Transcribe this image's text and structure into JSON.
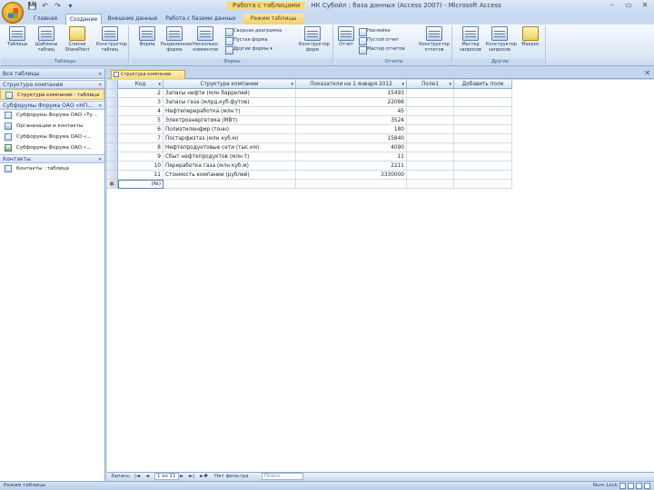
{
  "window": {
    "context_tab": "Работа с таблицами",
    "title": "НК Субойл : база данных (Access 2007) - Microsoft Access",
    "min": "–",
    "max": "▭",
    "close": "✕"
  },
  "qat": [
    "💾",
    "↶",
    "↷",
    "▾"
  ],
  "tabs": [
    {
      "label": "Главная"
    },
    {
      "label": "Создание"
    },
    {
      "label": "Внешние данные"
    },
    {
      "label": "Работа с базами данных"
    },
    {
      "label": "Режим таблицы"
    }
  ],
  "ribbon": {
    "groups": [
      {
        "name": "Таблицы",
        "buttons": [
          "Таблица",
          "Шаблоны таблиц",
          "Списки SharePoint",
          "Конструктор таблиц"
        ]
      },
      {
        "name": "Формы",
        "buttons": [
          "Форма",
          "Разделенная форма",
          "Несколько элементов",
          "Конструктор форм"
        ],
        "small": [
          "Сводная диаграмма",
          "Пустая форма",
          "Другие формы ▾"
        ]
      },
      {
        "name": "Отчеты",
        "buttons": [
          "Отчет",
          "Конструктор отчетов"
        ],
        "small": [
          "Наклейки",
          "Пустой отчет",
          "Мастер отчетов"
        ]
      },
      {
        "name": "Другие",
        "buttons": [
          "Мастер запросов",
          "Конструктор запросов",
          "Макрос"
        ]
      }
    ]
  },
  "nav": {
    "header": "Все таблицы",
    "groups": [
      {
        "label": "Структура компании",
        "chev": "«",
        "items": [
          {
            "label": "Структура компании : таблица",
            "type": "t",
            "selected": true
          }
        ]
      },
      {
        "label": "Субфорумы Форума ОАО «НП...",
        "chev": "«",
        "items": [
          {
            "label": "Субфорумы Форума ОАО «Ту...",
            "type": "t"
          },
          {
            "label": "Организации и контакты",
            "type": "q"
          },
          {
            "label": "Субфорумы Форума ОАО «...",
            "type": "t"
          },
          {
            "label": "Субфорумы Форума ОАО «...",
            "type": "f"
          }
        ]
      },
      {
        "label": "Контакты",
        "chev": "«",
        "items": [
          {
            "label": "Контакты : таблица",
            "type": "t"
          }
        ]
      }
    ]
  },
  "doc_tab": "Структура компании",
  "table": {
    "headers": [
      "Код",
      "Структура компании",
      "Показатели на 1 января 2012",
      "Поле1",
      "Добавить поле"
    ],
    "rows": [
      {
        "id": "2",
        "name": "Запасы нефти (млн баррелей)",
        "value": "15493",
        "f1": ""
      },
      {
        "id": "3",
        "name": "Запасы газа (млрд.куб.футов)",
        "value": "22086",
        "f1": ""
      },
      {
        "id": "4",
        "name": "Нефтепереработка (млн т)",
        "value": "45",
        "f1": ""
      },
      {
        "id": "5",
        "name": "Электроэнергетика (МВт)",
        "value": "3524",
        "f1": ""
      },
      {
        "id": "6",
        "name": "Полиэтиленфир (тонн)",
        "value": "180",
        "f1": ""
      },
      {
        "id": "7",
        "name": "Постарфизтаз (млн куб.м)",
        "value": "15840",
        "f1": ""
      },
      {
        "id": "8",
        "name": "Нефтепродуктовые сети (тыс.км)",
        "value": "4090",
        "f1": ""
      },
      {
        "id": "9",
        "name": "Сбыт нефтепродуктов (млн т)",
        "value": "11",
        "f1": ""
      },
      {
        "id": "10",
        "name": "Переработка газа (млн куб.м)",
        "value": "2211",
        "f1": ""
      },
      {
        "id": "11",
        "name": "Стоимость компании (рублей)",
        "value": "3330000",
        "f1": ""
      }
    ],
    "new_row_id": "(№)",
    "new_marker": "✱"
  },
  "recnav": {
    "label": "Запись:",
    "first": "|◄",
    "prev": "◄",
    "current": "1 из 11",
    "next": "►",
    "last": "►|",
    "new": "►✱",
    "filter": "Нет фильтра",
    "search": "Поиск"
  },
  "status": {
    "left": "Режим таблицы",
    "right": "Num Lock"
  }
}
